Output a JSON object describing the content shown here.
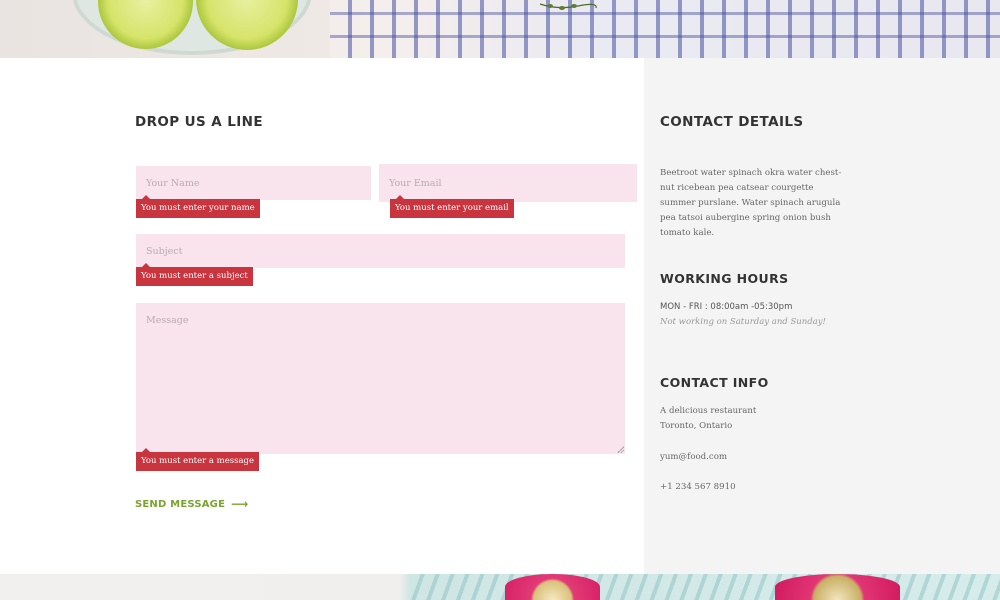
{
  "form": {
    "heading": "DROP US A LINE",
    "name_placeholder": "Your Name",
    "email_placeholder": "Your Email",
    "subject_placeholder": "Subject",
    "message_placeholder": "Message",
    "errors": {
      "name": "You must enter your name",
      "email": "You must enter your email",
      "subject": "You must enter a subject",
      "message": "You must enter a message"
    },
    "send_label": "SEND MESSAGE",
    "send_arrow": "⟶"
  },
  "details": {
    "heading": "CONTACT DETAILS",
    "text": "Beetroot water spinach okra water chest-nut ricebean pea catsear courgette summer purslane. Water spinach arugula pea tatsoi aubergine spring onion bush tomato kale."
  },
  "hours": {
    "heading": "WORKING HOURS",
    "line": "MON - FRI : 08:00am -05:30pm",
    "note": "Not working on Saturday and Sunday!"
  },
  "info": {
    "heading": "CONTACT INFO",
    "address_line1": "A delicious restaurant",
    "address_line2": "Toronto, Ontario",
    "email": "yum@food.com",
    "phone": "+1 234 567 8910"
  },
  "colors": {
    "field_bg": "#f9e4ee",
    "error_bg": "#c9353f",
    "accent_green": "#7aa42c",
    "panel_bg": "#f4f4f4"
  },
  "icons": {
    "send": "long-right-arrow-icon"
  }
}
